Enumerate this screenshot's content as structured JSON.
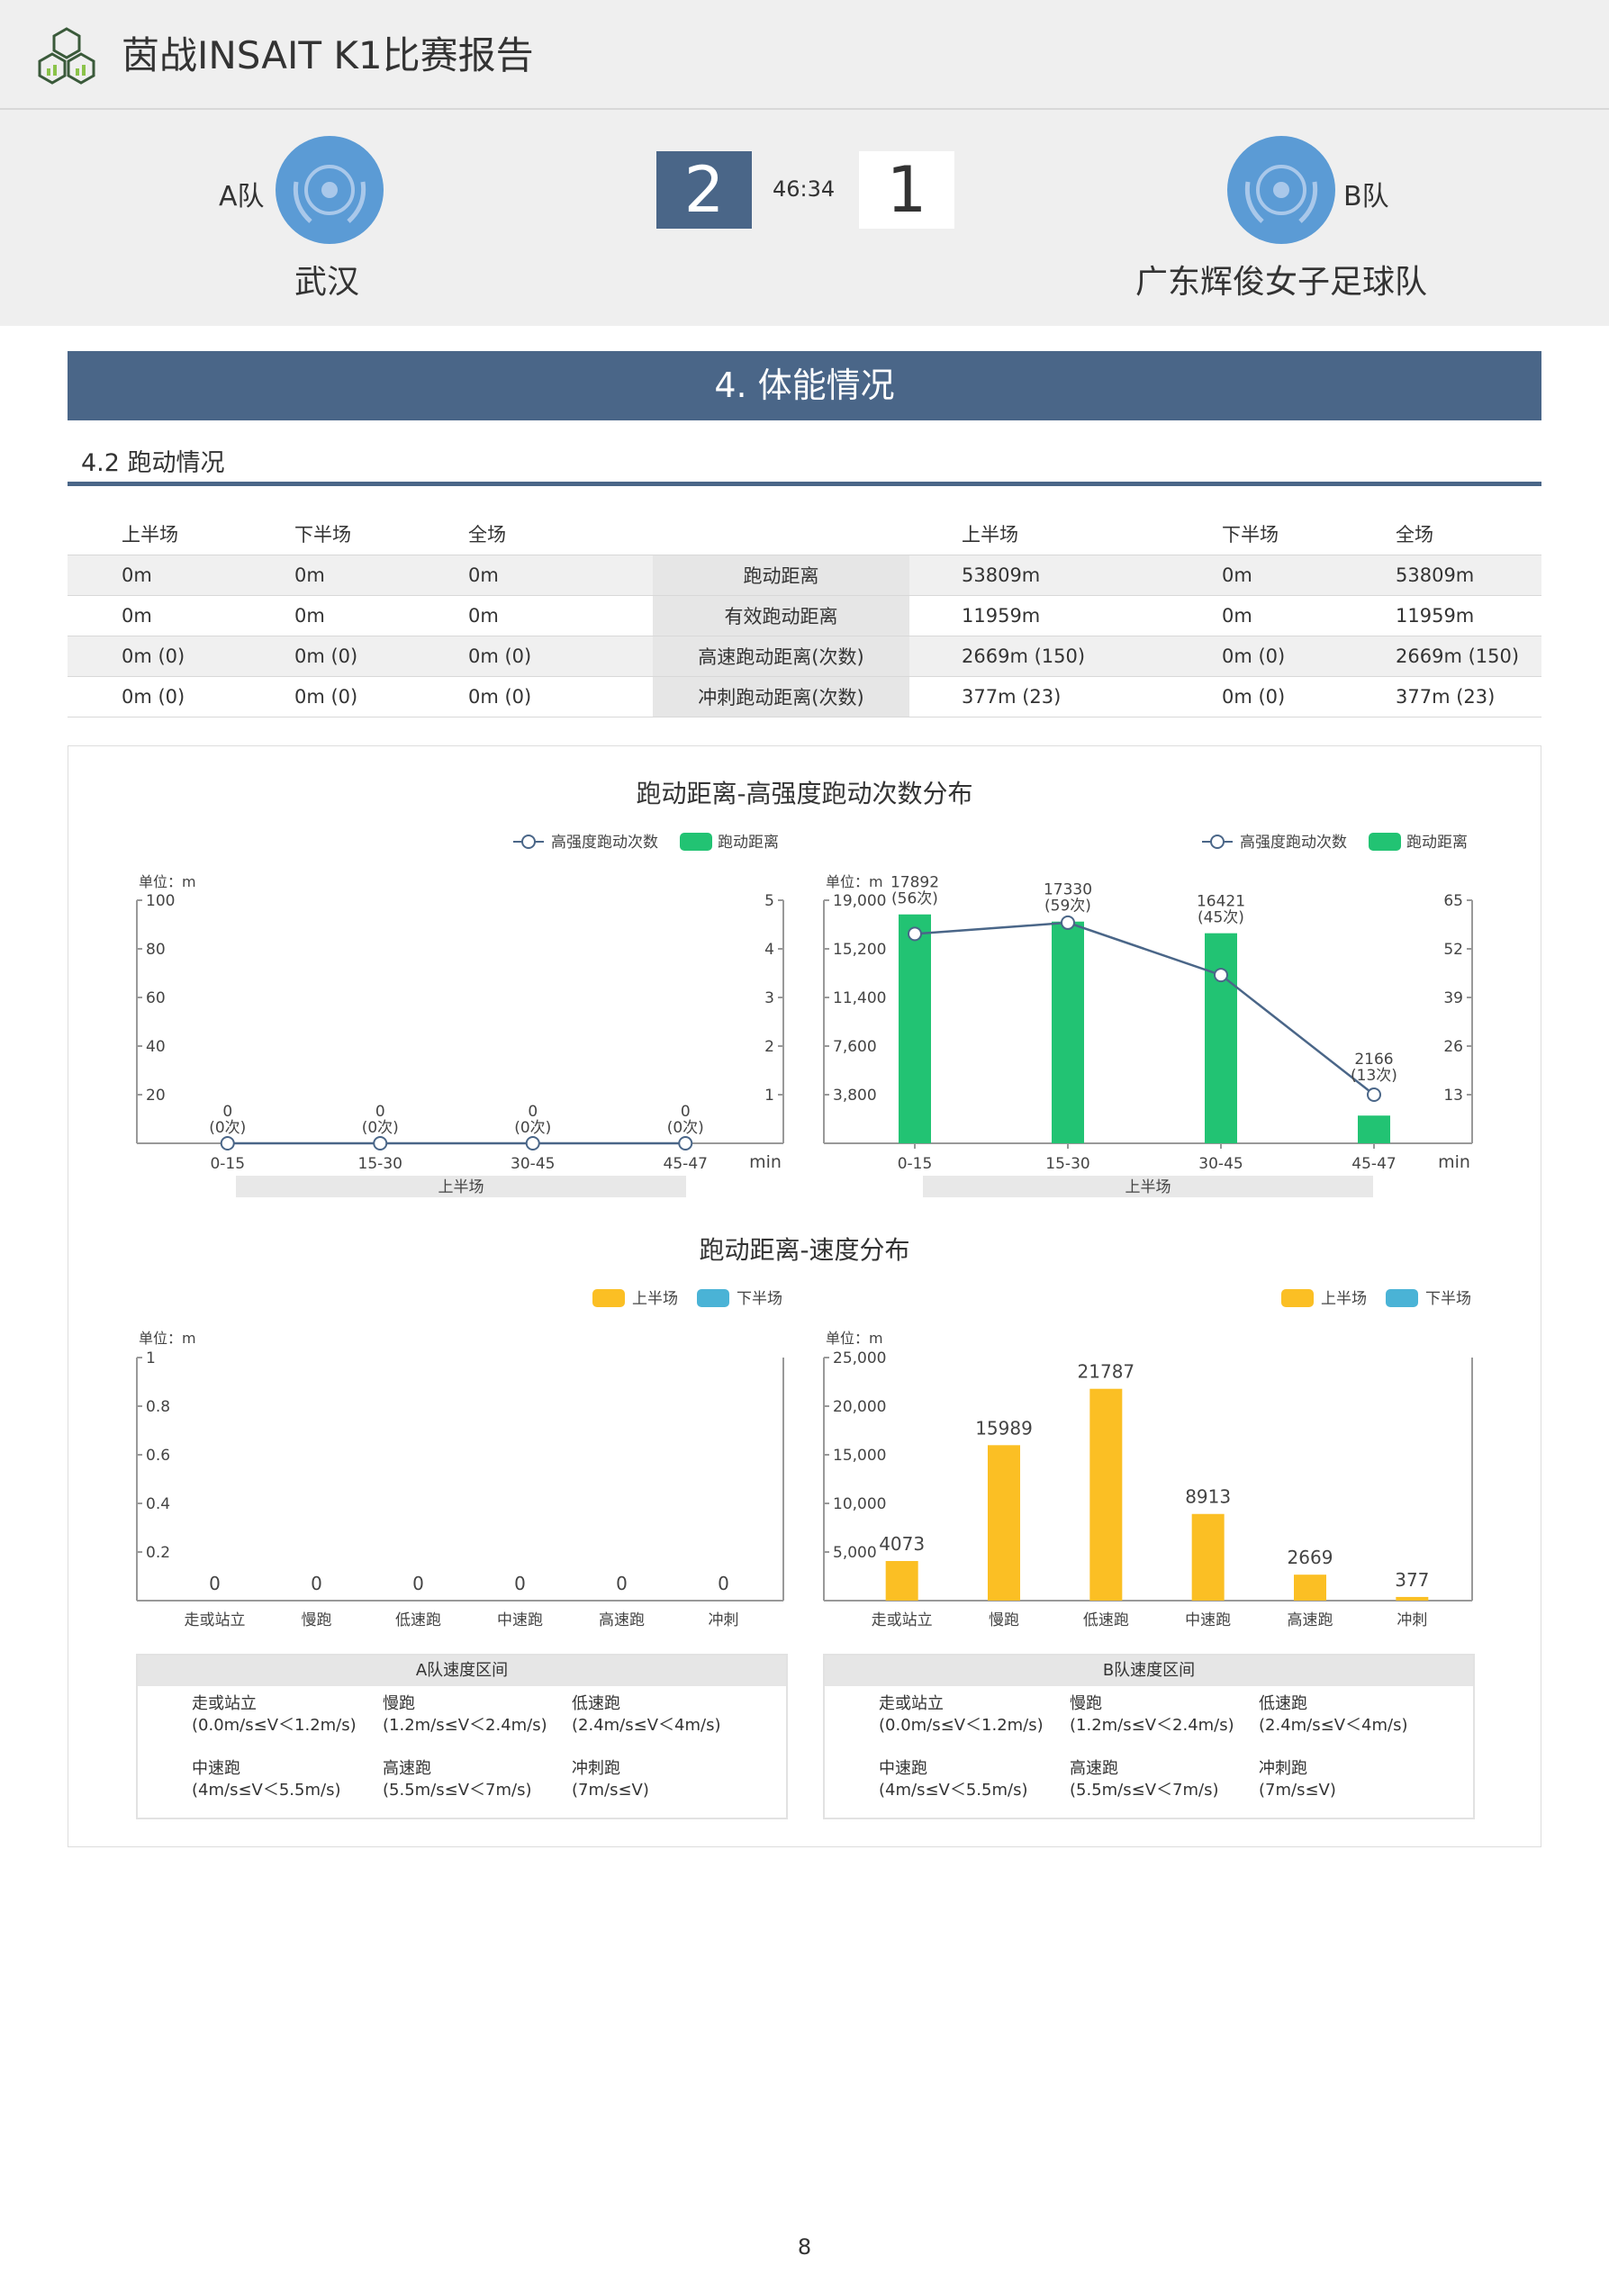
{
  "header": {
    "title": "茵战INSAIT K1比赛报告",
    "team_a_tag": "A队",
    "team_a_name": "武汉",
    "team_b_tag": "B队",
    "team_b_name": "广东辉俊女子足球队",
    "score_a": "2",
    "score_b": "1",
    "match_time": "46:34"
  },
  "section": {
    "title": "4. 体能情况",
    "subtitle": "4.2 跑动情况"
  },
  "stats_table": {
    "headers_a": [
      "上半场",
      "下半场",
      "全场"
    ],
    "headers_b": [
      "上半场",
      "下半场",
      "全场"
    ],
    "rows": [
      {
        "metric": "跑动距离",
        "a": [
          "0m",
          "0m",
          "0m"
        ],
        "b": [
          "53809m",
          "0m",
          "53809m"
        ]
      },
      {
        "metric": "有效跑动距离",
        "a": [
          "0m",
          "0m",
          "0m"
        ],
        "b": [
          "11959m",
          "0m",
          "11959m"
        ]
      },
      {
        "metric": "高速跑动距离(次数)",
        "a": [
          "0m (0)",
          "0m (0)",
          "0m (0)"
        ],
        "b": [
          "2669m (150)",
          "0m (0)",
          "2669m (150)"
        ]
      },
      {
        "metric": "冲刺跑动距离(次数)",
        "a": [
          "0m (0)",
          "0m (0)",
          "0m (0)"
        ],
        "b": [
          "377m (23)",
          "0m (0)",
          "377m (23)"
        ]
      }
    ]
  },
  "charts": {
    "title_1": "跑动距离-高强度跑动次数分布",
    "title_2": "跑动距离-速度分布",
    "legend_1": [
      "高强度跑动次数",
      "跑动距离"
    ],
    "legend_2": [
      "上半场",
      "下半场"
    ],
    "unit_label": "单位：m",
    "x_unit": "min",
    "period_label": "上半场",
    "colors": {
      "green": "#22c373",
      "line": "#4a6688",
      "yellow": "#fbbf24",
      "blue": "#4ab3d6"
    }
  },
  "chart_data": [
    {
      "type": "bar",
      "team": "A",
      "categories": [
        "0-15",
        "15-30",
        "30-45",
        "45-47"
      ],
      "series": [
        {
          "name": "跑动距离",
          "values": [
            0,
            0,
            0,
            0
          ]
        },
        {
          "name": "高强度跑动次数",
          "values": [
            0,
            0,
            0,
            0
          ]
        }
      ],
      "data_labels": [
        "0",
        "0",
        "0",
        "0"
      ],
      "count_labels": [
        "(0次)",
        "(0次)",
        "(0次)",
        "(0次)"
      ],
      "y_ticks": [
        "100",
        "80",
        "60",
        "40",
        "20"
      ],
      "y2_ticks": [
        "5",
        "4",
        "3",
        "2",
        "1"
      ],
      "ylim": [
        0,
        100
      ],
      "y2lim": [
        0,
        5
      ]
    },
    {
      "type": "bar",
      "team": "B",
      "categories": [
        "0-15",
        "15-30",
        "30-45",
        "45-47"
      ],
      "series": [
        {
          "name": "跑动距离",
          "values": [
            17892,
            17330,
            16421,
            2166
          ]
        },
        {
          "name": "高强度跑动次数",
          "values": [
            56,
            59,
            45,
            13
          ]
        }
      ],
      "data_labels": [
        "17892",
        "17330",
        "16421",
        "2166"
      ],
      "count_labels": [
        "(56次)",
        "(59次)",
        "(45次)",
        "(13次)"
      ],
      "y_ticks": [
        "19,000",
        "15,200",
        "11,400",
        "7,600",
        "3,800"
      ],
      "y2_ticks": [
        "65",
        "52",
        "39",
        "26",
        "13"
      ],
      "ylim": [
        0,
        19000
      ],
      "y2lim": [
        0,
        65
      ]
    },
    {
      "type": "bar",
      "team": "A",
      "categories": [
        "走或站立",
        "慢跑",
        "低速跑",
        "中速跑",
        "高速跑",
        "冲刺"
      ],
      "series": [
        {
          "name": "上半场",
          "values": [
            0,
            0,
            0,
            0,
            0,
            0
          ]
        },
        {
          "name": "下半场",
          "values": [
            0,
            0,
            0,
            0,
            0,
            0
          ]
        }
      ],
      "data_labels": [
        "0",
        "0",
        "0",
        "0",
        "0",
        "0"
      ],
      "y_ticks": [
        "1",
        "0.8",
        "0.6",
        "0.4",
        "0.2"
      ],
      "ylim": [
        0,
        1
      ]
    },
    {
      "type": "bar",
      "team": "B",
      "categories": [
        "走或站立",
        "慢跑",
        "低速跑",
        "中速跑",
        "高速跑",
        "冲刺"
      ],
      "series": [
        {
          "name": "上半场",
          "values": [
            4073,
            15989,
            21787,
            8913,
            2669,
            377
          ]
        },
        {
          "name": "下半场",
          "values": [
            0,
            0,
            0,
            0,
            0,
            0
          ]
        }
      ],
      "data_labels": [
        "4073",
        "15989",
        "21787",
        "8913",
        "2669",
        "377"
      ],
      "y_ticks": [
        "25,000",
        "20,000",
        "15,000",
        "10,000",
        "5,000"
      ],
      "ylim": [
        0,
        25000
      ]
    }
  ],
  "speed_zones": {
    "team_a_title": "A队速度区间",
    "team_b_title": "B队速度区间",
    "zones": [
      {
        "name": "走或站立",
        "range": "(0.0m/s≤V＜1.2m/s)"
      },
      {
        "name": "慢跑",
        "range": "(1.2m/s≤V＜2.4m/s)"
      },
      {
        "name": "低速跑",
        "range": "(2.4m/s≤V＜4m/s)"
      },
      {
        "name": "中速跑",
        "range": "(4m/s≤V＜5.5m/s)"
      },
      {
        "name": "高速跑",
        "range": "(5.5m/s≤V＜7m/s)"
      },
      {
        "name": "冲刺跑",
        "range": "(7m/s≤V)"
      }
    ]
  },
  "page_number": "8"
}
